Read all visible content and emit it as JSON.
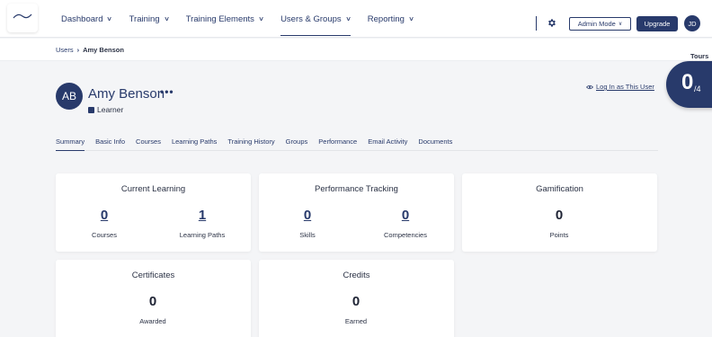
{
  "nav": {
    "items": [
      {
        "label": "Dashboard",
        "active": false
      },
      {
        "label": "Training",
        "active": false
      },
      {
        "label": "Training Elements",
        "active": false
      },
      {
        "label": "Users & Groups",
        "active": true
      },
      {
        "label": "Reporting",
        "active": false
      }
    ],
    "admin_mode_label": "Admin Mode",
    "upgrade_label": "Upgrade",
    "user_initials": "JD",
    "accent_color": "#283a6b"
  },
  "breadcrumb": {
    "parent": "Users",
    "current": "Amy Benson"
  },
  "tours": {
    "label": "Tours",
    "completed": "0",
    "total": "/4"
  },
  "profile": {
    "initials": "AB",
    "name": "Amy Benson",
    "more": "•••",
    "role": "Learner",
    "login_as": "Log In as This User"
  },
  "tabs": [
    {
      "label": "Summary",
      "active": true
    },
    {
      "label": "Basic Info",
      "active": false
    },
    {
      "label": "Courses",
      "active": false
    },
    {
      "label": "Learning Paths",
      "active": false
    },
    {
      "label": "Training History",
      "active": false
    },
    {
      "label": "Groups",
      "active": false
    },
    {
      "label": "Performance",
      "active": false
    },
    {
      "label": "Email Activity",
      "active": false
    },
    {
      "label": "Documents",
      "active": false
    }
  ],
  "cards": {
    "current_learning": {
      "title": "Current Learning",
      "metrics": [
        {
          "value": "0",
          "label": "Courses"
        },
        {
          "value": "1",
          "label": "Learning Paths"
        }
      ]
    },
    "performance_tracking": {
      "title": "Performance Tracking",
      "metrics": [
        {
          "value": "0",
          "label": "Skills"
        },
        {
          "value": "0",
          "label": "Competencies"
        }
      ]
    },
    "gamification": {
      "title": "Gamification",
      "metrics": [
        {
          "value": "0",
          "label": "Points"
        }
      ]
    },
    "certificates": {
      "title": "Certificates",
      "metrics": [
        {
          "value": "0",
          "label": "Awarded"
        }
      ]
    },
    "credits": {
      "title": "Credits",
      "metrics": [
        {
          "value": "0",
          "label": "Earned"
        }
      ]
    }
  }
}
